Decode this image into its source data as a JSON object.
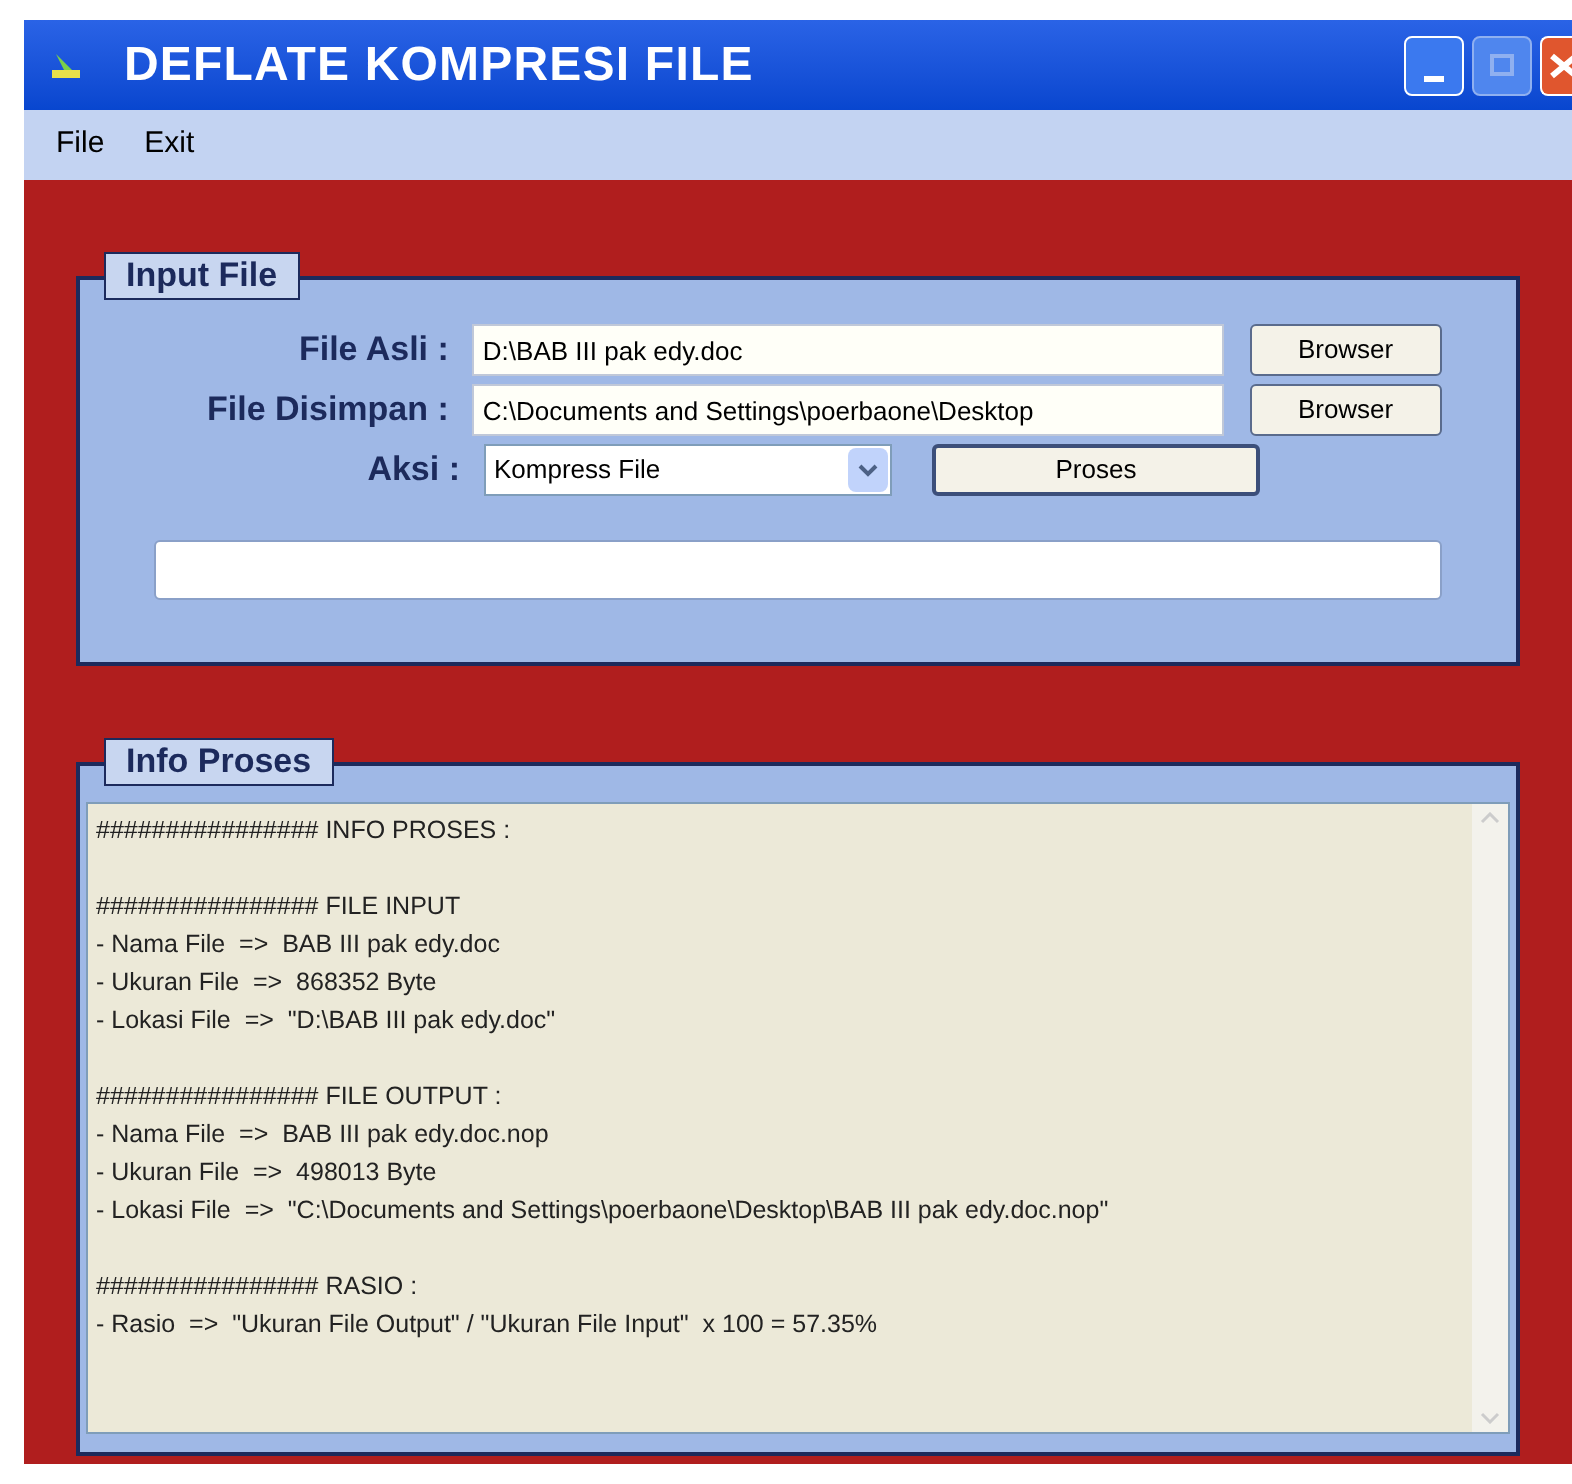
{
  "window": {
    "title": "DEFLATE KOMPRESI FILE"
  },
  "menu": [
    "File",
    "Exit"
  ],
  "input_panel": {
    "legend": "Input File",
    "rows": [
      {
        "kind": "text",
        "label": "File Asli :",
        "value": "D:\\BAB III pak edy.doc",
        "button": "Browser"
      },
      {
        "kind": "text",
        "label": "File Disimpan :",
        "value": "C:\\Documents and Settings\\poerbaone\\Desktop",
        "button": "Browser"
      },
      {
        "kind": "select",
        "label": "Aksi :",
        "value": "Kompress File",
        "button": "Proses"
      }
    ]
  },
  "info_panel": {
    "legend": "Info Proses",
    "sections": [
      [
        "################ INFO PROSES :"
      ],
      [
        "################ FILE INPUT",
        "- Nama File  =>  BAB III pak edy.doc",
        "- Ukuran File  =>  868352 Byte",
        "- Lokasi File  =>  \"D:\\BAB III pak edy.doc\""
      ],
      [
        "################ FILE OUTPUT :",
        "- Nama File  =>  BAB III pak edy.doc.nop",
        "- Ukuran File  =>  498013 Byte",
        "- Lokasi File  =>  \"C:\\Documents and Settings\\poerbaone\\Desktop\\BAB III pak edy.doc.nop\""
      ],
      [
        "################ RASIO :",
        "- Rasio  =>  \"Ukuran File Output\" / \"Ukuran File Input\"  x 100 = 57.35%"
      ]
    ]
  }
}
